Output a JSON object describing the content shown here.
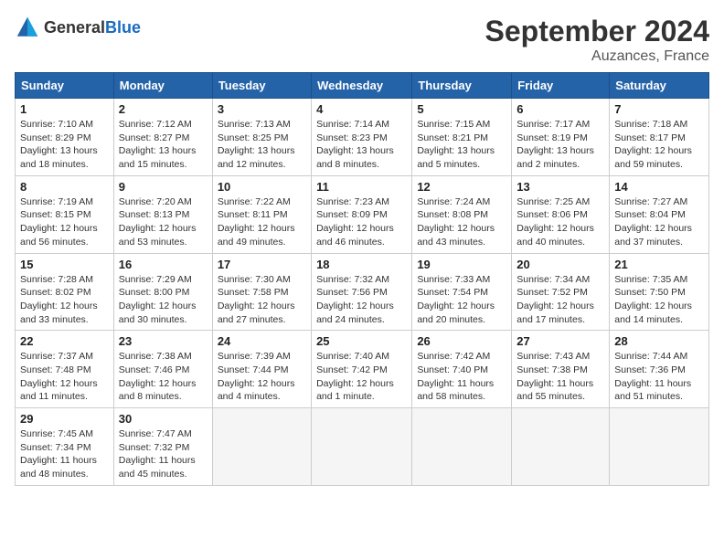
{
  "logo": {
    "text_general": "General",
    "text_blue": "Blue"
  },
  "title": "September 2024",
  "subtitle": "Auzances, France",
  "weekdays": [
    "Sunday",
    "Monday",
    "Tuesday",
    "Wednesday",
    "Thursday",
    "Friday",
    "Saturday"
  ],
  "weeks": [
    [
      {
        "day": "1",
        "sunrise": "Sunrise: 7:10 AM",
        "sunset": "Sunset: 8:29 PM",
        "daylight": "Daylight: 13 hours and 18 minutes."
      },
      {
        "day": "2",
        "sunrise": "Sunrise: 7:12 AM",
        "sunset": "Sunset: 8:27 PM",
        "daylight": "Daylight: 13 hours and 15 minutes."
      },
      {
        "day": "3",
        "sunrise": "Sunrise: 7:13 AM",
        "sunset": "Sunset: 8:25 PM",
        "daylight": "Daylight: 13 hours and 12 minutes."
      },
      {
        "day": "4",
        "sunrise": "Sunrise: 7:14 AM",
        "sunset": "Sunset: 8:23 PM",
        "daylight": "Daylight: 13 hours and 8 minutes."
      },
      {
        "day": "5",
        "sunrise": "Sunrise: 7:15 AM",
        "sunset": "Sunset: 8:21 PM",
        "daylight": "Daylight: 13 hours and 5 minutes."
      },
      {
        "day": "6",
        "sunrise": "Sunrise: 7:17 AM",
        "sunset": "Sunset: 8:19 PM",
        "daylight": "Daylight: 13 hours and 2 minutes."
      },
      {
        "day": "7",
        "sunrise": "Sunrise: 7:18 AM",
        "sunset": "Sunset: 8:17 PM",
        "daylight": "Daylight: 12 hours and 59 minutes."
      }
    ],
    [
      {
        "day": "8",
        "sunrise": "Sunrise: 7:19 AM",
        "sunset": "Sunset: 8:15 PM",
        "daylight": "Daylight: 12 hours and 56 minutes."
      },
      {
        "day": "9",
        "sunrise": "Sunrise: 7:20 AM",
        "sunset": "Sunset: 8:13 PM",
        "daylight": "Daylight: 12 hours and 53 minutes."
      },
      {
        "day": "10",
        "sunrise": "Sunrise: 7:22 AM",
        "sunset": "Sunset: 8:11 PM",
        "daylight": "Daylight: 12 hours and 49 minutes."
      },
      {
        "day": "11",
        "sunrise": "Sunrise: 7:23 AM",
        "sunset": "Sunset: 8:09 PM",
        "daylight": "Daylight: 12 hours and 46 minutes."
      },
      {
        "day": "12",
        "sunrise": "Sunrise: 7:24 AM",
        "sunset": "Sunset: 8:08 PM",
        "daylight": "Daylight: 12 hours and 43 minutes."
      },
      {
        "day": "13",
        "sunrise": "Sunrise: 7:25 AM",
        "sunset": "Sunset: 8:06 PM",
        "daylight": "Daylight: 12 hours and 40 minutes."
      },
      {
        "day": "14",
        "sunrise": "Sunrise: 7:27 AM",
        "sunset": "Sunset: 8:04 PM",
        "daylight": "Daylight: 12 hours and 37 minutes."
      }
    ],
    [
      {
        "day": "15",
        "sunrise": "Sunrise: 7:28 AM",
        "sunset": "Sunset: 8:02 PM",
        "daylight": "Daylight: 12 hours and 33 minutes."
      },
      {
        "day": "16",
        "sunrise": "Sunrise: 7:29 AM",
        "sunset": "Sunset: 8:00 PM",
        "daylight": "Daylight: 12 hours and 30 minutes."
      },
      {
        "day": "17",
        "sunrise": "Sunrise: 7:30 AM",
        "sunset": "Sunset: 7:58 PM",
        "daylight": "Daylight: 12 hours and 27 minutes."
      },
      {
        "day": "18",
        "sunrise": "Sunrise: 7:32 AM",
        "sunset": "Sunset: 7:56 PM",
        "daylight": "Daylight: 12 hours and 24 minutes."
      },
      {
        "day": "19",
        "sunrise": "Sunrise: 7:33 AM",
        "sunset": "Sunset: 7:54 PM",
        "daylight": "Daylight: 12 hours and 20 minutes."
      },
      {
        "day": "20",
        "sunrise": "Sunrise: 7:34 AM",
        "sunset": "Sunset: 7:52 PM",
        "daylight": "Daylight: 12 hours and 17 minutes."
      },
      {
        "day": "21",
        "sunrise": "Sunrise: 7:35 AM",
        "sunset": "Sunset: 7:50 PM",
        "daylight": "Daylight: 12 hours and 14 minutes."
      }
    ],
    [
      {
        "day": "22",
        "sunrise": "Sunrise: 7:37 AM",
        "sunset": "Sunset: 7:48 PM",
        "daylight": "Daylight: 12 hours and 11 minutes."
      },
      {
        "day": "23",
        "sunrise": "Sunrise: 7:38 AM",
        "sunset": "Sunset: 7:46 PM",
        "daylight": "Daylight: 12 hours and 8 minutes."
      },
      {
        "day": "24",
        "sunrise": "Sunrise: 7:39 AM",
        "sunset": "Sunset: 7:44 PM",
        "daylight": "Daylight: 12 hours and 4 minutes."
      },
      {
        "day": "25",
        "sunrise": "Sunrise: 7:40 AM",
        "sunset": "Sunset: 7:42 PM",
        "daylight": "Daylight: 12 hours and 1 minute."
      },
      {
        "day": "26",
        "sunrise": "Sunrise: 7:42 AM",
        "sunset": "Sunset: 7:40 PM",
        "daylight": "Daylight: 11 hours and 58 minutes."
      },
      {
        "day": "27",
        "sunrise": "Sunrise: 7:43 AM",
        "sunset": "Sunset: 7:38 PM",
        "daylight": "Daylight: 11 hours and 55 minutes."
      },
      {
        "day": "28",
        "sunrise": "Sunrise: 7:44 AM",
        "sunset": "Sunset: 7:36 PM",
        "daylight": "Daylight: 11 hours and 51 minutes."
      }
    ],
    [
      {
        "day": "29",
        "sunrise": "Sunrise: 7:45 AM",
        "sunset": "Sunset: 7:34 PM",
        "daylight": "Daylight: 11 hours and 48 minutes."
      },
      {
        "day": "30",
        "sunrise": "Sunrise: 7:47 AM",
        "sunset": "Sunset: 7:32 PM",
        "daylight": "Daylight: 11 hours and 45 minutes."
      },
      null,
      null,
      null,
      null,
      null
    ]
  ]
}
